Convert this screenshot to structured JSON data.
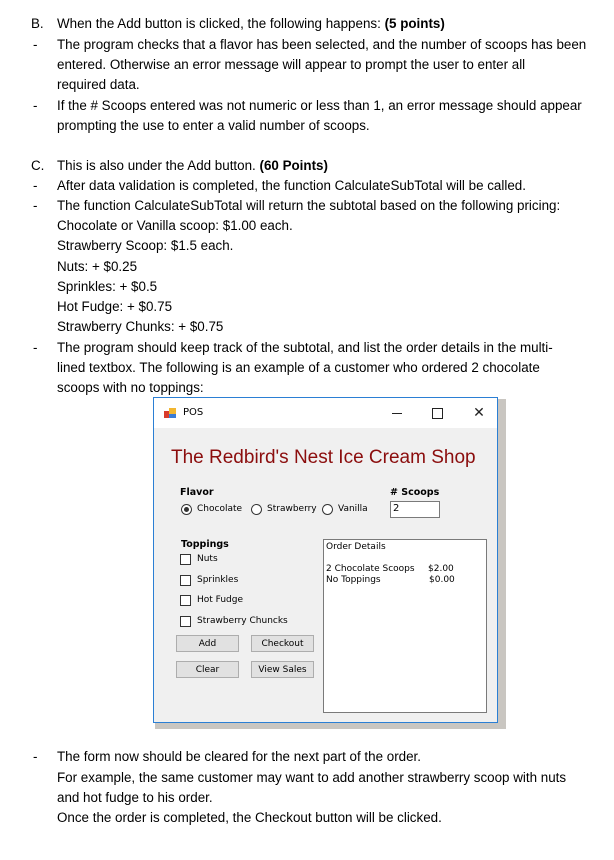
{
  "sectionB": {
    "marker": "B.",
    "heading": "When the Add button is clicked, the following happens:",
    "points": "(5 points)",
    "bullets": [
      {
        "marker": "-",
        "lines": [
          "The program checks that a flavor has been selected, and the number of scoops has been",
          "entered. Otherwise an error message will appear to prompt the user to enter all",
          "required data."
        ]
      },
      {
        "marker": "-",
        "lines": [
          "If the # Scoops entered was not numeric or less than 1, an error message should appear",
          "prompting the use to enter a valid number of scoops."
        ]
      }
    ]
  },
  "sectionC": {
    "marker": "C.",
    "heading": "This is also under the Add button.",
    "points": "(60 Points)",
    "bullets": [
      {
        "marker": "-",
        "lines": [
          "After data validation is completed, the function CalculateSubTotal will be called."
        ]
      },
      {
        "marker": "-",
        "lines": [
          "The function CalculateSubTotal will return the subtotal based on the following pricing:",
          "Chocolate or Vanilla scoop: $1.00 each.",
          "Strawberry Scoop: $1.5 each.",
          "Nuts:  + $0.25",
          "Sprinkles:  + $0.5",
          "Hot Fudge:  + $0.75",
          "Strawberry Chunks:  + $0.75"
        ]
      },
      {
        "marker": "-",
        "lines": [
          "The program should keep track of the subtotal, and list the order details in the multi-",
          "lined textbox. The following is an example of a customer who ordered 2 chocolate",
          "scoops with no toppings:"
        ]
      }
    ]
  },
  "window": {
    "title": "POS",
    "icons": {
      "app": "app-form-icon",
      "minimize": "minimize-icon",
      "maximize": "maximize-icon",
      "close": "close-icon"
    },
    "close_glyph": "✕",
    "shop_title": "The Redbird's Nest Ice Cream Shop",
    "title_color": "#8b0d0d",
    "flavor_label": "Flavor",
    "flavors": [
      {
        "label": "Chocolate",
        "selected": true
      },
      {
        "label": "Strawberry",
        "selected": false
      },
      {
        "label": "Vanilla",
        "selected": false
      }
    ],
    "scoops_label": "# Scoops",
    "scoops_value": "2",
    "toppings_label": "Toppings",
    "toppings": [
      {
        "label": "Nuts",
        "checked": false
      },
      {
        "label": "Sprinkles",
        "checked": false
      },
      {
        "label": "Hot Fudge",
        "checked": false
      },
      {
        "label": "Strawberry Chuncks",
        "checked": false
      }
    ],
    "buttons": {
      "add": "Add",
      "checkout": "Checkout",
      "clear": "Clear",
      "view_sales": "View Sales"
    },
    "order_details": {
      "header": "Order Details",
      "items": [
        {
          "text": "2 Chocolate Scoops",
          "amount": "$2.00"
        },
        {
          "text": "No Toppings",
          "amount": "$0.00"
        }
      ]
    }
  },
  "closing": {
    "marker": "-",
    "lines": [
      "The form now should be cleared for the next part of the order.",
      "For example, the same customer may want to add another strawberry scoop with nuts",
      "and hot fudge to his order.",
      "Once the order is completed, the Checkout button will be clicked."
    ]
  }
}
